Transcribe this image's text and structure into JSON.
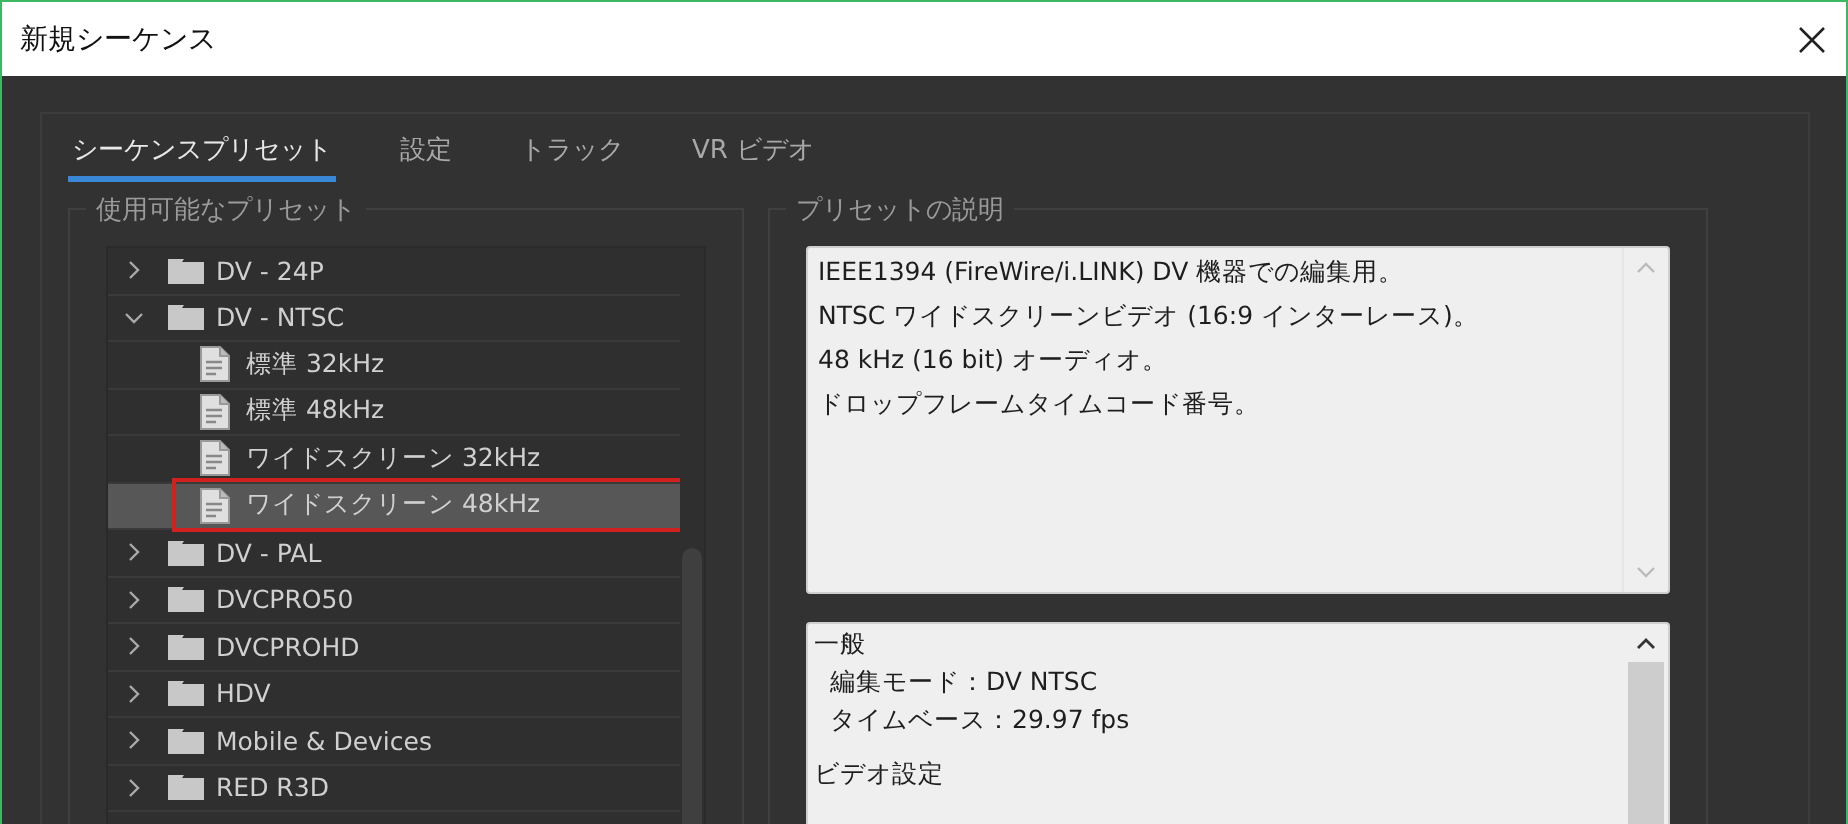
{
  "window": {
    "title": "新規シーケンス"
  },
  "tabs": [
    {
      "label": "シーケンスプリセット",
      "selected": true
    },
    {
      "label": "設定",
      "selected": false
    },
    {
      "label": "トラック",
      "selected": false
    },
    {
      "label": "VR ビデオ",
      "selected": false
    }
  ],
  "presets": {
    "legend": "使用可能なプリセット",
    "items": [
      {
        "label": "DV - 24P",
        "kind": "folder",
        "expanded": false,
        "selected": false
      },
      {
        "label": "DV - NTSC",
        "kind": "folder",
        "expanded": true,
        "selected": false,
        "children": [
          {
            "label": "標準 32kHz",
            "kind": "preset",
            "selected": false
          },
          {
            "label": "標準 48kHz",
            "kind": "preset",
            "selected": false
          },
          {
            "label": "ワイドスクリーン 32kHz",
            "kind": "preset",
            "selected": false
          },
          {
            "label": "ワイドスクリーン 48kHz",
            "kind": "preset",
            "selected": true,
            "highlighted": true
          }
        ]
      },
      {
        "label": "DV - PAL",
        "kind": "folder",
        "expanded": false,
        "selected": false
      },
      {
        "label": "DVCPRO50",
        "kind": "folder",
        "expanded": false,
        "selected": false
      },
      {
        "label": "DVCPROHD",
        "kind": "folder",
        "expanded": false,
        "selected": false
      },
      {
        "label": "HDV",
        "kind": "folder",
        "expanded": false,
        "selected": false
      },
      {
        "label": "Mobile & Devices",
        "kind": "folder",
        "expanded": false,
        "selected": false
      },
      {
        "label": "RED R3D",
        "kind": "folder",
        "expanded": false,
        "selected": false
      }
    ]
  },
  "description": {
    "legend": "プリセットの説明",
    "lines": [
      "IEEE1394 (FireWire/i.LINK) DV 機器での編集用。",
      "NTSC ワイドスクリーンビデオ (16:9 インターレース)。",
      "48 kHz (16 bit) オーディオ。",
      "ドロップフレームタイムコード番号。"
    ]
  },
  "details": {
    "sections": [
      {
        "heading": "一般",
        "entries": [
          "編集モード：DV NTSC",
          "タイムベース：29.97 fps"
        ]
      },
      {
        "heading": "ビデオ設定"
      }
    ]
  }
}
